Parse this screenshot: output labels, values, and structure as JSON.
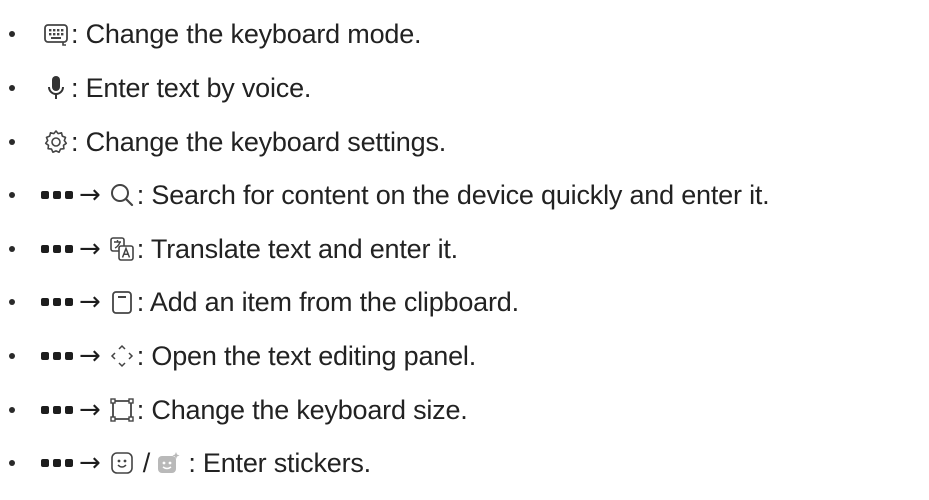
{
  "items": [
    {
      "text": ": Change the keyboard mode.",
      "icon": "keyboard-icon"
    },
    {
      "text": ": Enter text by voice.",
      "icon": "microphone-icon"
    },
    {
      "text": ": Change the keyboard settings.",
      "icon": "gear-icon"
    },
    {
      "text": ": Search for content on the device quickly and enter it.",
      "icon": "search-icon",
      "via_more": true
    },
    {
      "text": ": Translate text and enter it.",
      "icon": "translate-icon",
      "via_more": true
    },
    {
      "text": ": Add an item from the clipboard.",
      "icon": "clipboard-icon",
      "via_more": true
    },
    {
      "text": ": Open the text editing panel.",
      "icon": "text-editing-icon",
      "via_more": true
    },
    {
      "text": ": Change the keyboard size.",
      "icon": "keyboard-size-icon",
      "via_more": true
    },
    {
      "text": ": Enter stickers.",
      "icon": "sticker-icon",
      "icon_alt": "ar-emoji-sticker-icon",
      "separator": "/",
      "via_more": true
    }
  ],
  "colors": {
    "text": "#222222",
    "icon_stroke": "#444444",
    "sticker_fill": "#b9b9b9"
  }
}
